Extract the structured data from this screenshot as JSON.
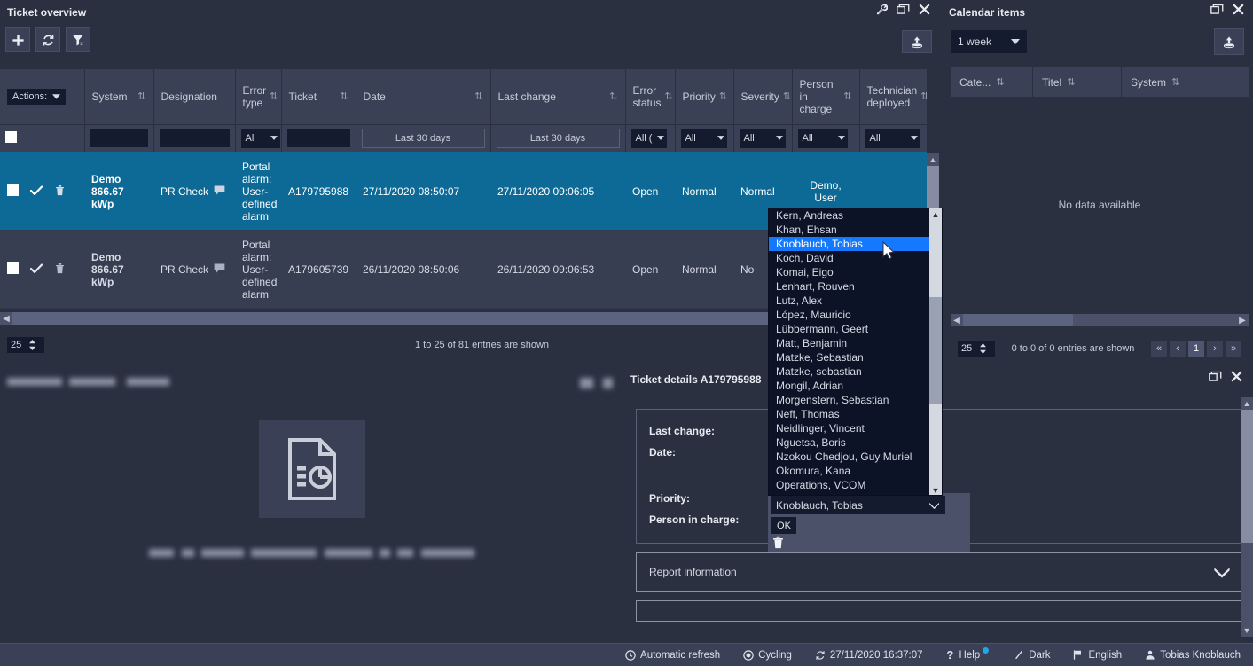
{
  "ticket_overview": {
    "title": "Ticket overview",
    "window_buttons": [
      "wrench-icon",
      "restore-icon",
      "close-icon"
    ],
    "toolbar": [
      {
        "name": "add-ticket-button",
        "icon": "plus-icon"
      },
      {
        "name": "refresh-button",
        "icon": "refresh-icon"
      },
      {
        "name": "clear-filter-button",
        "icon": "filter-clear-icon"
      }
    ],
    "export_button": "export-icon",
    "columns": [
      {
        "label": "Actions:",
        "sortable": false
      },
      {
        "label": "System",
        "sortable": true
      },
      {
        "label": "Designation",
        "sortable": false
      },
      {
        "label": "Error type",
        "sortable": true
      },
      {
        "label": "Ticket",
        "sortable": true
      },
      {
        "label": "Date",
        "sortable": true
      },
      {
        "label": "Last change",
        "sortable": true
      },
      {
        "label": "Error status",
        "sortable": true
      },
      {
        "label": "Priority",
        "sortable": true
      },
      {
        "label": "Severity",
        "sortable": true
      },
      {
        "label": "Person in charge",
        "sortable": true
      },
      {
        "label": "Technician deployed",
        "sortable": true
      }
    ],
    "filters": {
      "system": "",
      "designation": "",
      "error_type": "All",
      "ticket": "",
      "date": "Last 30 days",
      "last_change": "Last 30 days",
      "error_status": "All (",
      "priority": "All",
      "severity": "All",
      "person_in_charge": "All",
      "technician_deployed": "All"
    },
    "rows": [
      {
        "selected": true,
        "system": "Demo 866.67 kWp",
        "designation": "PR Check",
        "error_type": "Portal alarm: User-defined alarm",
        "ticket": "A179795988",
        "date": "27/11/2020 08:50:07",
        "last_change": "27/11/2020 09:06:05",
        "error_status": "Open",
        "priority": "Normal",
        "severity": "Normal",
        "person_in_charge": "Demo, User",
        "technician_deployed": ""
      },
      {
        "selected": false,
        "system": "Demo 866.67 kWp",
        "designation": "PR Check",
        "error_type": "Portal alarm: User-defined alarm",
        "ticket": "A179605739",
        "date": "26/11/2020 08:50:06",
        "last_change": "26/11/2020 09:06:53",
        "error_status": "Open",
        "priority": "Normal",
        "severity": "No",
        "person_in_charge": "",
        "technician_deployed": ""
      }
    ],
    "page_size": "25",
    "entries_text": "1 to 25 of 81 entries are shown"
  },
  "calendar_items": {
    "title": "Calendar items",
    "window_buttons": [
      "restore-icon",
      "close-icon"
    ],
    "range_select": "1 week",
    "export_button": "export-icon",
    "columns": [
      "Cate...",
      "Titel",
      "System"
    ],
    "empty_text": "No data available",
    "page_size": "25",
    "entries_text": "0 to 0 of 0 entries are shown",
    "pagination": [
      "«",
      "‹",
      "1",
      "›",
      "»"
    ],
    "active_page": "1"
  },
  "report_panel": {
    "title_redacted": true,
    "empty_icon": "document-chart-icon",
    "message_redacted": true,
    "window_buttons": [
      "restore-icon",
      "close-icon"
    ]
  },
  "ticket_details": {
    "title": "Ticket details A179795988",
    "window_buttons": [
      "restore-icon",
      "close-icon"
    ],
    "fields": [
      {
        "label": "Last change:",
        "value": ""
      },
      {
        "label": "Date:",
        "value": ""
      },
      {
        "label": "Priority:",
        "value": ""
      },
      {
        "label": "Person in charge:",
        "value": "Knoblauch, Tobias"
      }
    ],
    "ok_button": "OK",
    "delete_icon": "trash-icon",
    "sections": [
      {
        "label": "Report information",
        "expand_icon": "chevron-down-icon"
      }
    ]
  },
  "person_dropdown": {
    "selected": "Knoblauch, Tobias",
    "items": [
      "Kern, Andreas",
      "Khan, Ehsan",
      "Knoblauch, Tobias",
      "Koch, David",
      "Komai, Eigo",
      "Lenhart, Rouven",
      "Lutz, Alex",
      "López, Mauricio",
      "Lübbermann, Geert",
      "Matt, Benjamin",
      "Matzke, Sebastian",
      "Matzke, sebastian",
      "Mongil, Adrian",
      "Morgenstern, Sebastian",
      "Neff, Thomas",
      "Neidlinger, Vincent",
      "Nguetsa, Boris",
      "Nzokou Chedjou, Guy Muriel",
      "Okomura, Kana",
      "Operations, VCOM"
    ]
  },
  "footer": {
    "items": [
      {
        "name": "automatic-refresh",
        "icon": "clock-icon",
        "label": "Automatic refresh"
      },
      {
        "name": "cycling",
        "icon": "cycle-icon",
        "label": "Cycling"
      },
      {
        "name": "timestamp",
        "icon": "refresh-icon",
        "label": "27/11/2020 16:37:07"
      },
      {
        "name": "help",
        "icon": "question-icon",
        "label": "Help",
        "badge": true
      },
      {
        "name": "theme",
        "icon": "pen-icon",
        "label": "Dark"
      },
      {
        "name": "language",
        "icon": "flag-icon",
        "label": "English"
      },
      {
        "name": "user",
        "icon": "person-icon",
        "label": "Tobias Knoblauch"
      }
    ]
  },
  "colors": {
    "bg": "#2b3040",
    "header": "#3a4055",
    "selected_row": "#0d6a96",
    "accent_blue": "#1479ff",
    "green": "#4fd35a",
    "input": "#151b2e"
  }
}
